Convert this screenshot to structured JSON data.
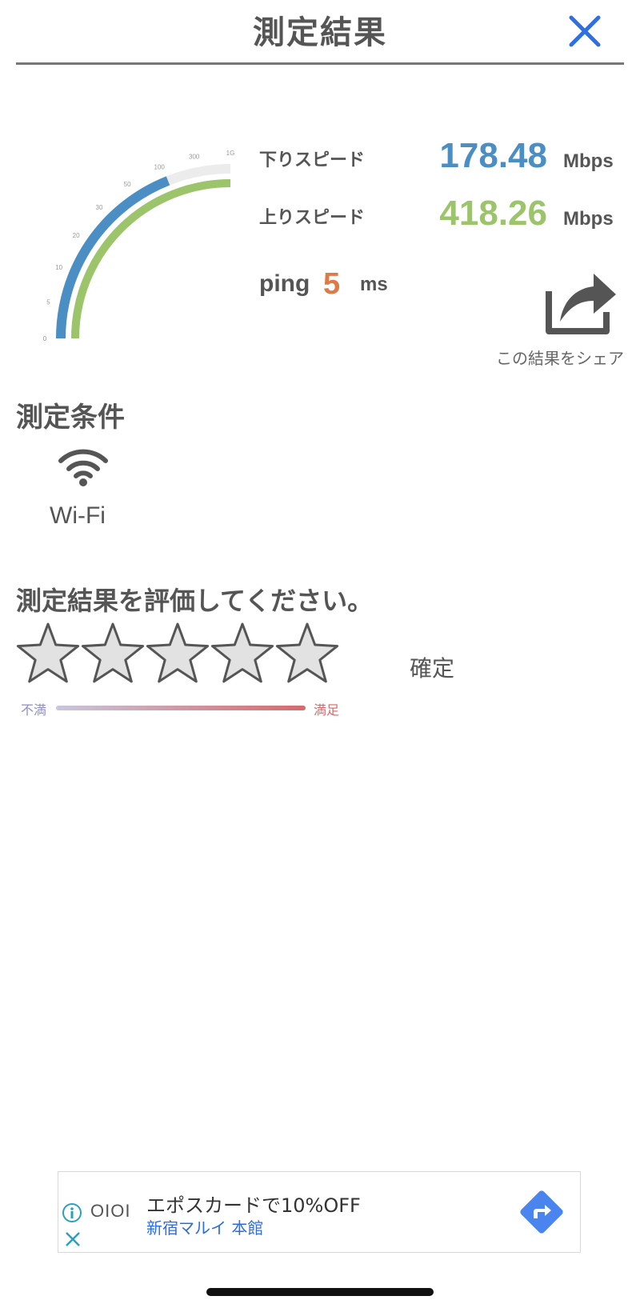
{
  "header": {
    "title": "測定結果"
  },
  "result": {
    "download_label": "下りスピード",
    "download_value": "178.48",
    "download_unit": "Mbps",
    "upload_label": "上りスピード",
    "upload_value": "418.26",
    "upload_unit": "Mbps",
    "ping_label": "ping",
    "ping_value": "5",
    "ping_unit": "ms",
    "share_caption": "この結果をシェア"
  },
  "gauge": {
    "ticks": [
      "0",
      "5",
      "10",
      "20",
      "30",
      "50",
      "100",
      "300",
      "1G"
    ],
    "download_fraction": 0.76,
    "upload_fraction": 1.0
  },
  "conditions": {
    "title": "測定条件",
    "network": "Wi-Fi",
    "network_icon": "wifi-icon"
  },
  "rating": {
    "title": "測定結果を評価してください。",
    "star_count": 5,
    "confirm_label": "確定",
    "low_label": "不満",
    "high_label": "満足"
  },
  "ad": {
    "brand": "OIOI",
    "title": "エポスカードで10%OFF",
    "subtitle": "新宿マルイ 本館"
  },
  "colors": {
    "download": "#4a8ec4",
    "upload": "#9cc56b",
    "ping": "#e07a45",
    "close": "#2f6fe0",
    "ad_cta": "#4a84ee"
  }
}
